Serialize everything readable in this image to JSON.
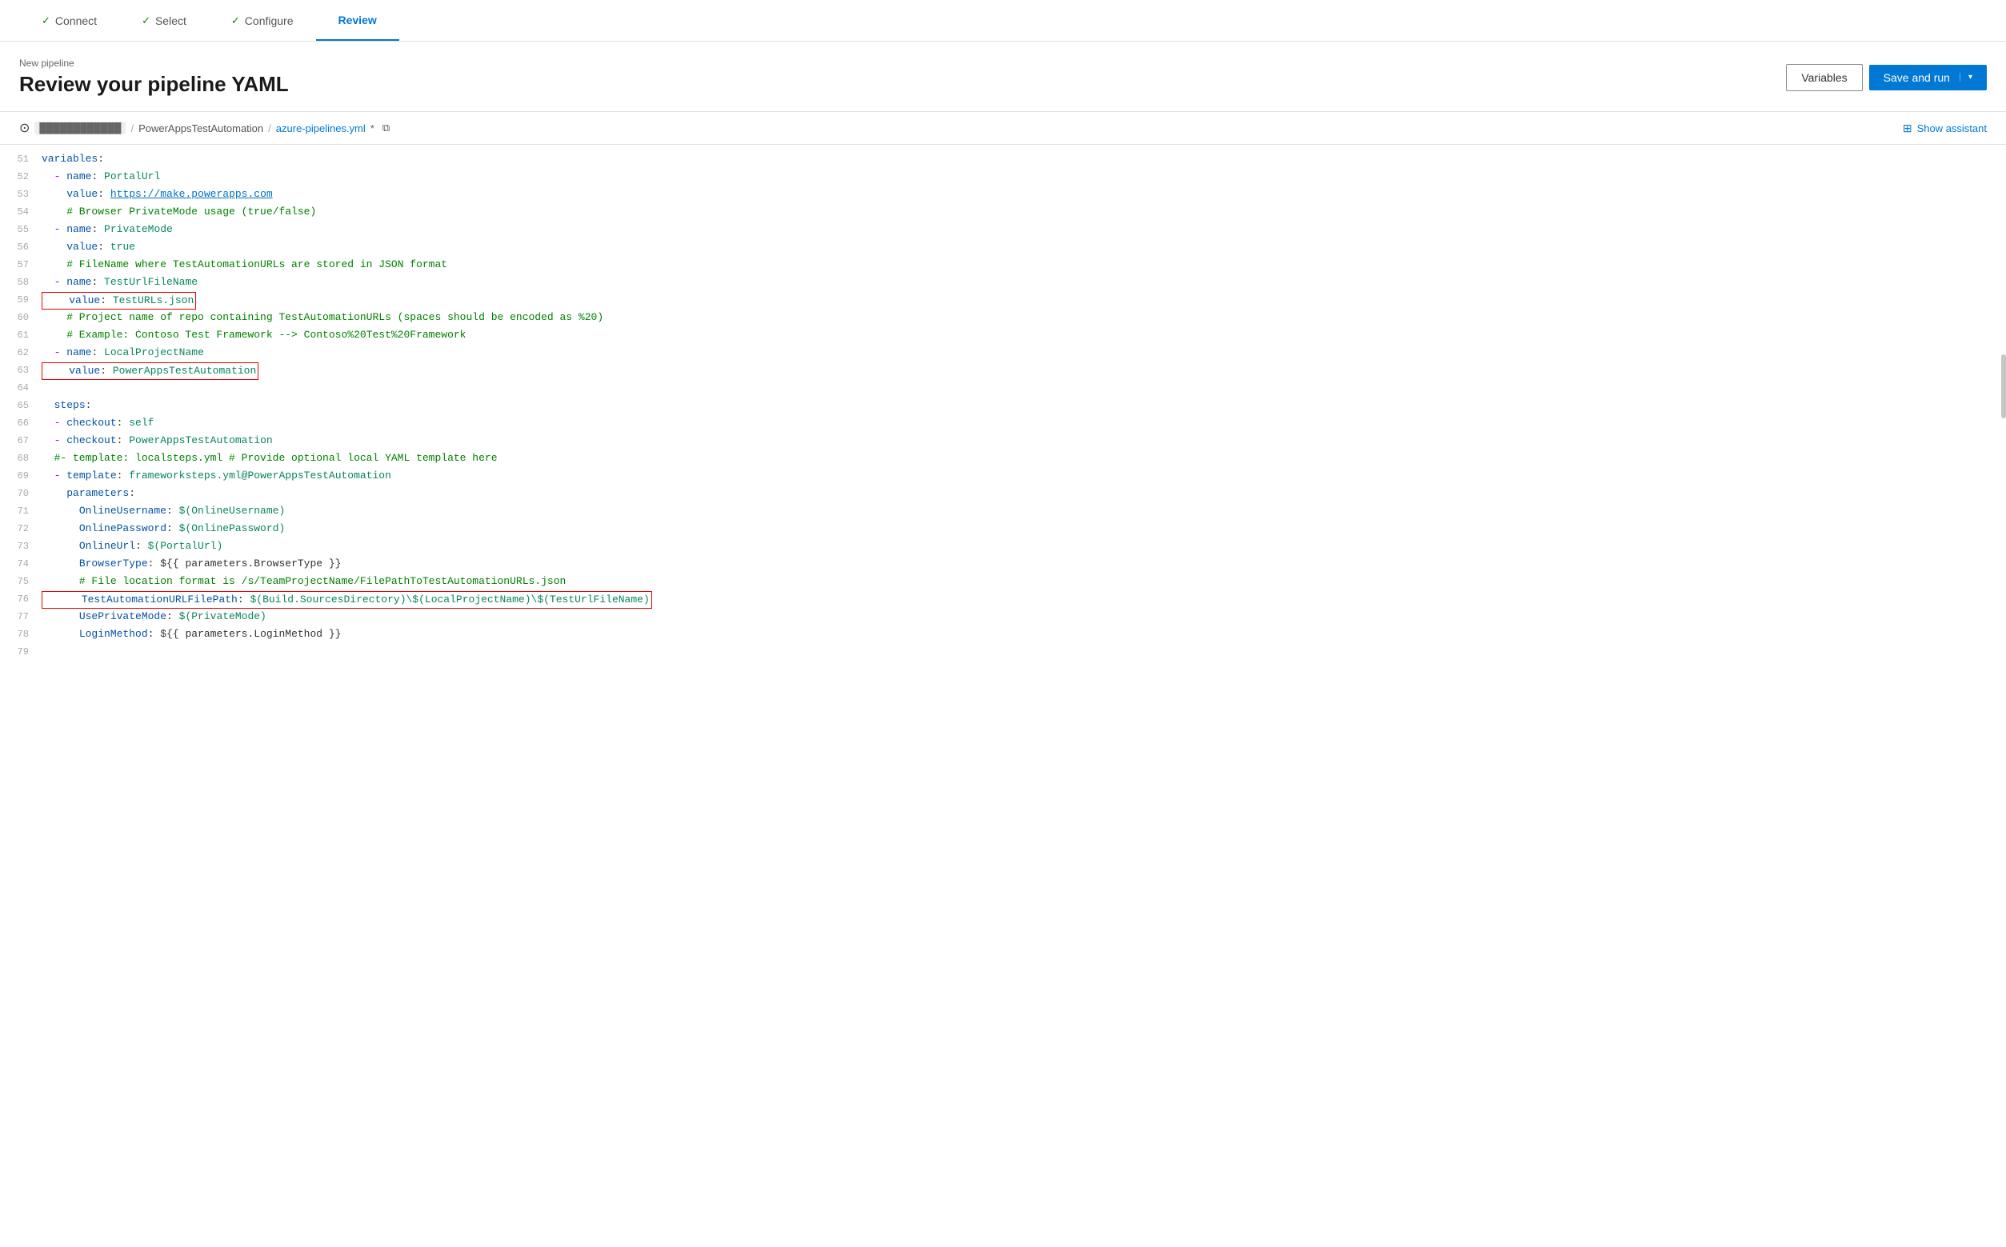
{
  "nav": {
    "steps": [
      {
        "label": "Connect",
        "checked": true,
        "active": false
      },
      {
        "label": "Select",
        "checked": true,
        "active": false
      },
      {
        "label": "Configure",
        "checked": true,
        "active": false
      },
      {
        "label": "Review",
        "checked": false,
        "active": true
      }
    ]
  },
  "header": {
    "breadcrumb": "New pipeline",
    "title": "Review your pipeline YAML",
    "variables_btn": "Variables",
    "save_run_btn": "Save and run"
  },
  "file_bar": {
    "repo": "PowerAppsTestAutomation",
    "separator": "/",
    "filename": "azure-pipelines.yml",
    "modified": "*",
    "show_assistant": "Show assistant"
  },
  "code": {
    "lines": [
      {
        "num": 51,
        "content": "variables:"
      },
      {
        "num": 52,
        "content": "  - name: PortalUrl"
      },
      {
        "num": 53,
        "content": "    value: https://make.powerapps.com"
      },
      {
        "num": 54,
        "content": "    # Browser PrivateMode usage (true/false)"
      },
      {
        "num": 55,
        "content": "  - name: PrivateMode"
      },
      {
        "num": 56,
        "content": "    value: true"
      },
      {
        "num": 57,
        "content": "    # FileName where TestAutomationURLs are stored in JSON format"
      },
      {
        "num": 58,
        "content": "  - name: TestUrlFileName"
      },
      {
        "num": 59,
        "content": "    value: TestURLs.json",
        "highlight": true
      },
      {
        "num": 60,
        "content": "    # Project name of repo containing TestAutomationURLs (spaces should be encoded as %20)"
      },
      {
        "num": 61,
        "content": "    # Example: Contoso Test Framework --> Contoso%20Test%20Framework"
      },
      {
        "num": 62,
        "content": "  - name: LocalProjectName"
      },
      {
        "num": 63,
        "content": "    value: PowerAppsTestAutomation",
        "highlight": true
      },
      {
        "num": 64,
        "content": ""
      },
      {
        "num": 65,
        "content": "  steps:"
      },
      {
        "num": 66,
        "content": "  - checkout: self"
      },
      {
        "num": 67,
        "content": "  - checkout: PowerAppsTestAutomation"
      },
      {
        "num": 68,
        "content": "  #- template: localsteps.yml # Provide optional local YAML template here"
      },
      {
        "num": 69,
        "content": "  - template: frameworksteps.yml@PowerAppsTestAutomation"
      },
      {
        "num": 70,
        "content": "    parameters:"
      },
      {
        "num": 71,
        "content": "      OnlineUsername: $(OnlineUsername)"
      },
      {
        "num": 72,
        "content": "      OnlinePassword: $(OnlinePassword)"
      },
      {
        "num": 73,
        "content": "      OnlineUrl: $(PortalUrl)"
      },
      {
        "num": 74,
        "content": "      BrowserType: ${{ parameters.BrowserType }}"
      },
      {
        "num": 75,
        "content": "      # File location format is /s/TeamProjectName/FilePathToTestAutomationURLs.json"
      },
      {
        "num": 76,
        "content": "      TestAutomationURLFilePath: $(Build.SourcesDirectory)\\$(LocalProjectName)\\$(TestUrlFileName)",
        "highlight": true
      },
      {
        "num": 77,
        "content": "      UsePrivateMode: $(PrivateMode)"
      },
      {
        "num": 78,
        "content": "      LoginMethod: ${{ parameters.LoginMethod }}"
      },
      {
        "num": 79,
        "content": ""
      }
    ]
  }
}
